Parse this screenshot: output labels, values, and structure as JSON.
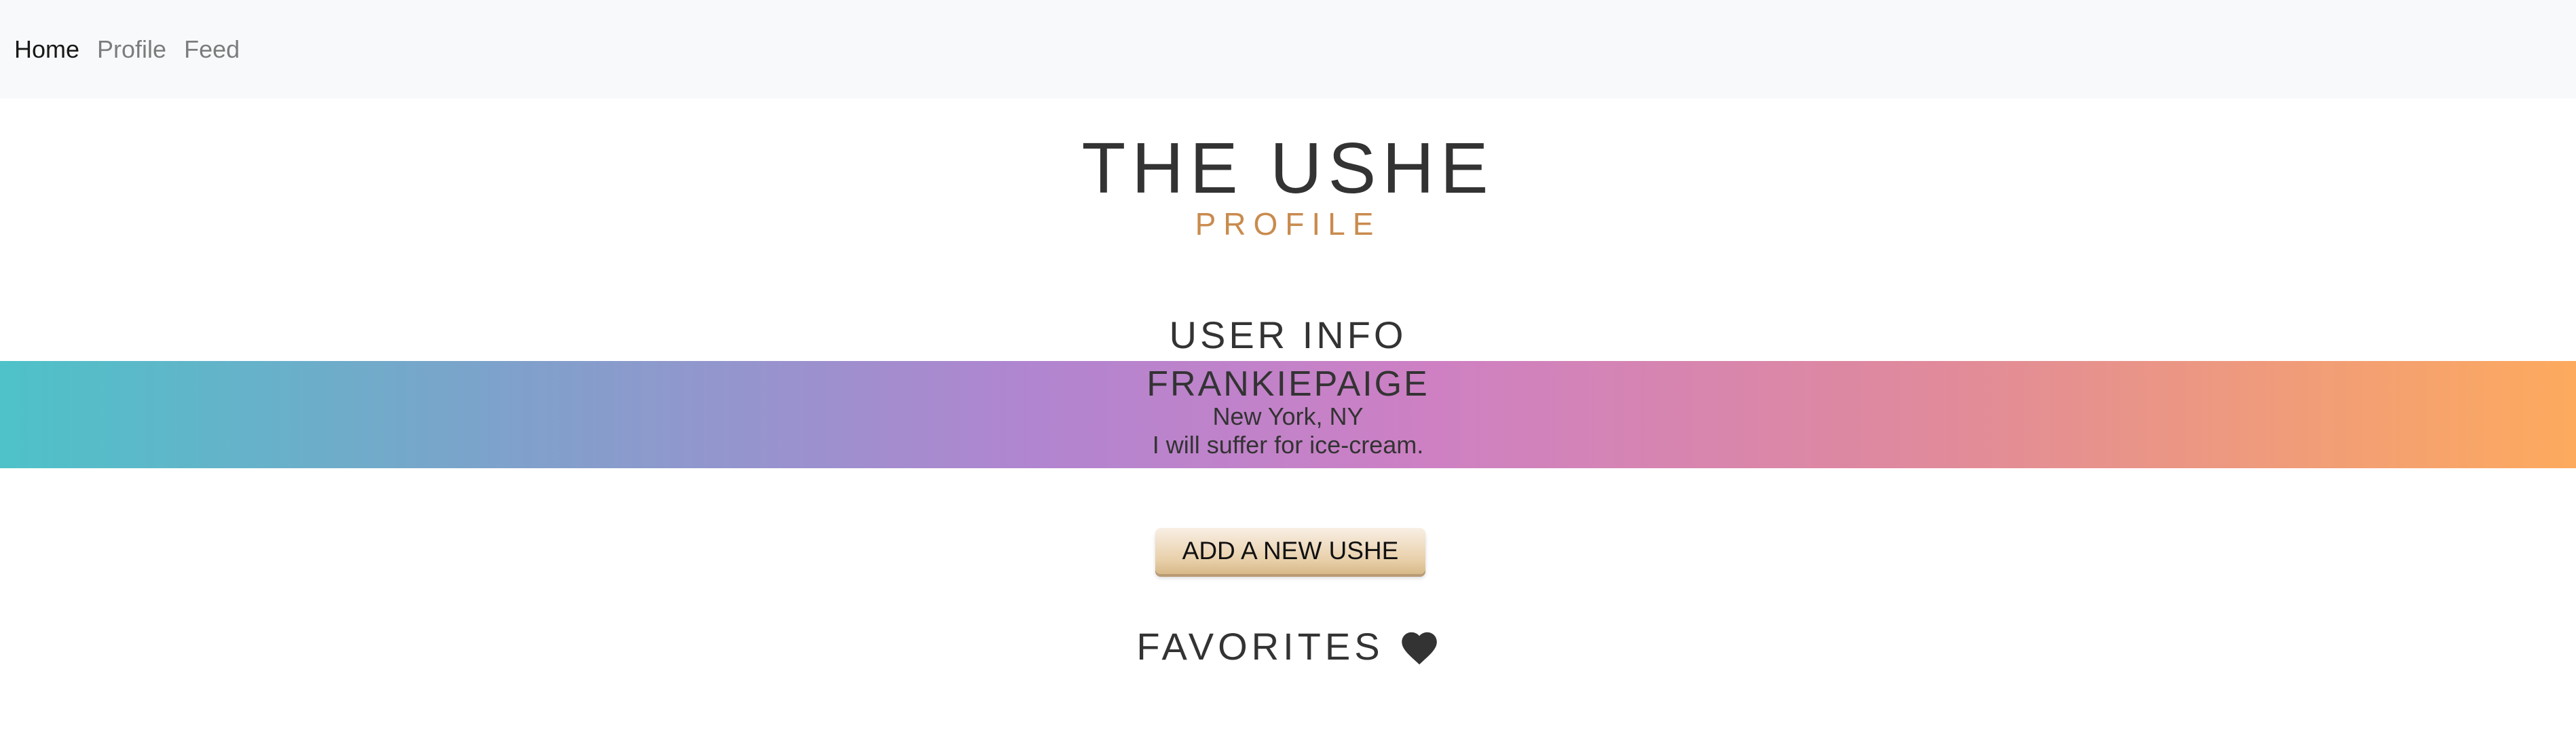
{
  "nav": {
    "items": [
      {
        "label": "Home",
        "active": true
      },
      {
        "label": "Profile",
        "active": false
      },
      {
        "label": "Feed",
        "active": false
      }
    ]
  },
  "header": {
    "title": "THE USHE",
    "subtitle": "PROFILE"
  },
  "user_info": {
    "heading": "USER INFO",
    "username": "FRANKIEPAIGE",
    "location": "New York, NY",
    "bio": "I will suffer for ice-cream."
  },
  "actions": {
    "add_label": "ADD A NEW USHE"
  },
  "favorites": {
    "heading": "FAVORITES",
    "icon": "heart-icon"
  },
  "colors": {
    "nav_bg": "#f8f9fa",
    "subtitle": "#c98b4e",
    "text": "#333333",
    "gradient_start": "#4ec2c8",
    "gradient_mid": "#b185d0",
    "gradient_end": "#fdaa5e"
  }
}
